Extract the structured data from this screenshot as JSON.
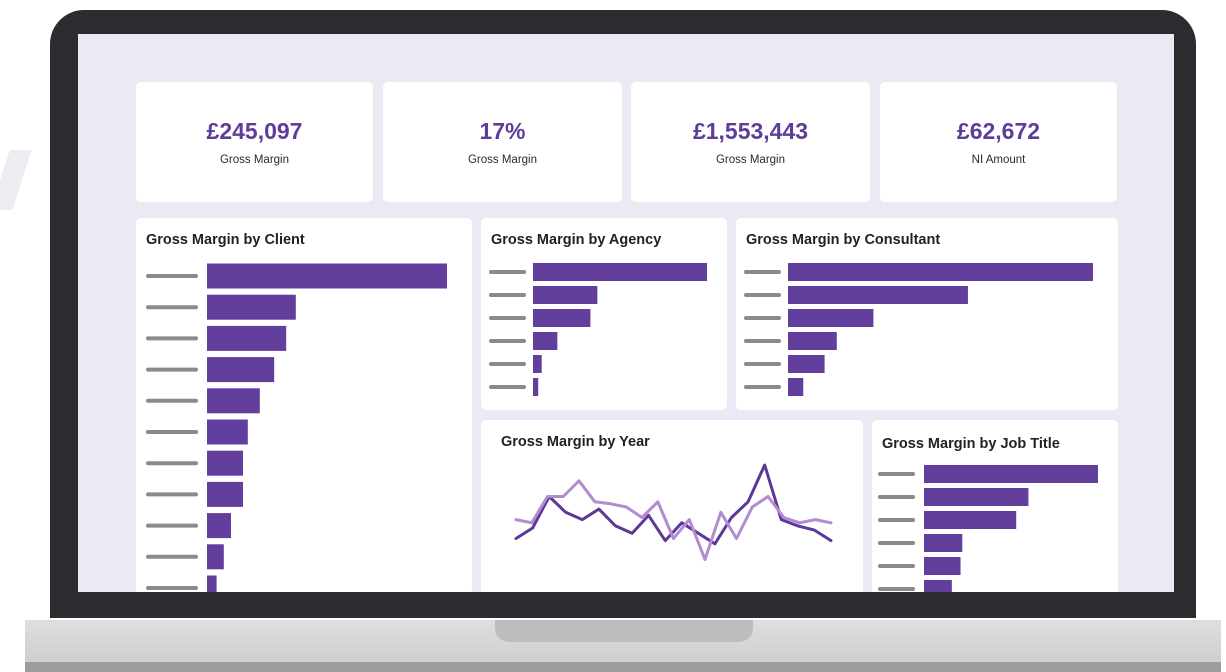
{
  "kpis": [
    {
      "value": "£245,097",
      "label": "Gross Margin"
    },
    {
      "value": "17%",
      "label": "Gross Margin"
    },
    {
      "value": "£1,553,443",
      "label": "Gross Margin"
    },
    {
      "value": "£62,672",
      "label": "NI Amount"
    }
  ],
  "colors": {
    "bar": "#623e9d",
    "line_dark": "#5b3a96",
    "line_light": "#b28bd0",
    "placeholder": "#8a8a8a",
    "screen_bg": "#ece8f4"
  },
  "chart_data": [
    {
      "type": "bar",
      "orientation": "horizontal",
      "title": "Gross Margin by Client",
      "values": [
        100,
        37,
        33,
        28,
        22,
        17,
        15,
        15,
        10,
        7,
        4
      ],
      "value_scale": "relative"
    },
    {
      "type": "bar",
      "orientation": "horizontal",
      "title": "Gross Margin by Agency",
      "values": [
        100,
        37,
        33,
        14,
        5,
        3
      ],
      "value_scale": "relative"
    },
    {
      "type": "bar",
      "orientation": "horizontal",
      "title": "Gross Margin by Consultant",
      "values": [
        100,
        59,
        28,
        16,
        12,
        5
      ],
      "value_scale": "relative"
    },
    {
      "type": "line",
      "title": "Gross Margin by Year",
      "series": [
        {
          "values": [
            30,
            40,
            70,
            55,
            48,
            58,
            42,
            35,
            52,
            28,
            45,
            35,
            25,
            50,
            65,
            100,
            48,
            42,
            38,
            28
          ]
        },
        {
          "values": [
            48,
            45,
            70,
            70,
            85,
            65,
            63,
            60,
            50,
            65,
            30,
            48,
            10,
            55,
            30,
            60,
            70,
            50,
            45,
            48,
            45
          ]
        }
      ]
    },
    {
      "type": "bar",
      "orientation": "horizontal",
      "title": "Gross Margin by Job Title",
      "values": [
        100,
        60,
        53,
        22,
        21,
        16
      ],
      "value_scale": "relative"
    }
  ]
}
